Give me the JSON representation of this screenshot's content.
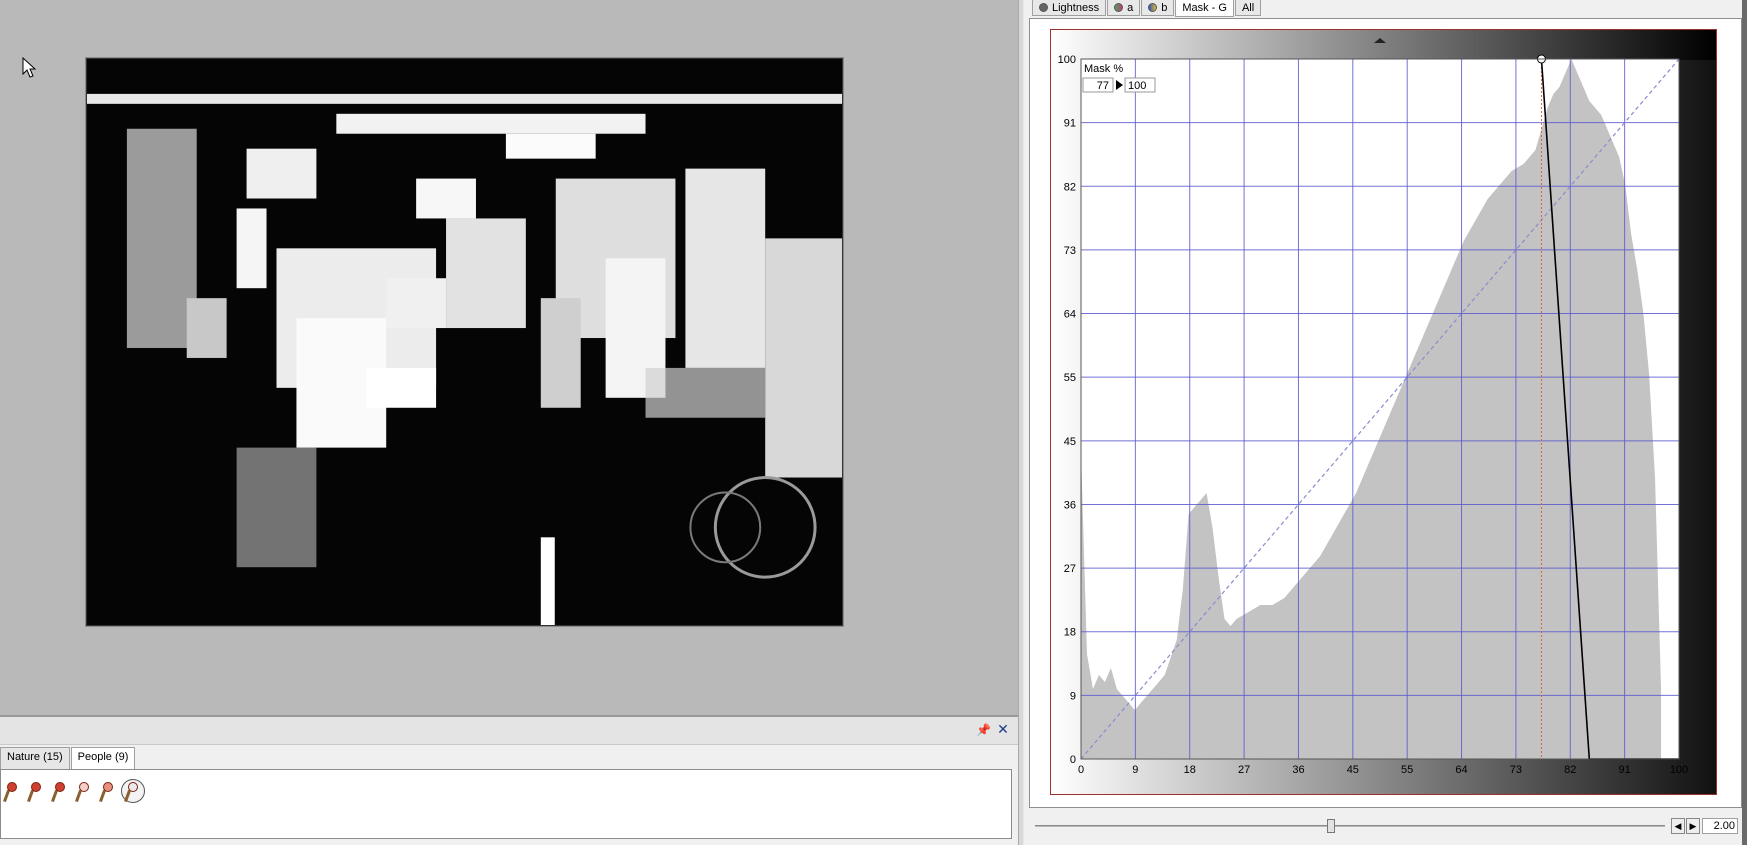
{
  "colors": {
    "viewer_bg": "#b9b9b9",
    "grid": "#5a5ad0",
    "histogram": "#c3c3c3",
    "curve": "#000000",
    "diagonal": "#8a8ad0",
    "marker": "#e06040"
  },
  "bottom_panel": {
    "tabs": [
      {
        "label": "Nature (15)"
      },
      {
        "label": "People (9)"
      }
    ],
    "active_tab": "People (9)",
    "pin_icon": "pin-icon",
    "close_icon": "close-icon"
  },
  "curve_panel": {
    "tabs": [
      {
        "label": "Lightness"
      },
      {
        "label": "a"
      },
      {
        "label": "b"
      },
      {
        "label": "Mask - G"
      },
      {
        "label": "All"
      }
    ],
    "active_tab": "Mask - G",
    "readout_label": "Mask %",
    "readout_input": "77",
    "readout_output": "100",
    "zoom_value": "2.00"
  },
  "chart_data": {
    "type": "area",
    "xlabel": "",
    "ylabel": "",
    "xlim": [
      0,
      100
    ],
    "ylim": [
      0,
      100
    ],
    "x_ticks": [
      "0",
      "9",
      "18",
      "27",
      "36",
      "45",
      "55",
      "64",
      "73",
      "82",
      "91",
      "100"
    ],
    "y_ticks": [
      "0",
      "9",
      "18",
      "27",
      "36",
      "45",
      "55",
      "64",
      "73",
      "82",
      "91",
      "100"
    ],
    "grid": true,
    "histogram": {
      "x": [
        0,
        1,
        2,
        3,
        4,
        5,
        6,
        7,
        8,
        9,
        10,
        12,
        14,
        16,
        17,
        18,
        19,
        20,
        21,
        22,
        23,
        24,
        25,
        26,
        28,
        30,
        32,
        34,
        36,
        38,
        40,
        42,
        44,
        46,
        48,
        50,
        52,
        54,
        56,
        58,
        60,
        62,
        64,
        66,
        68,
        70,
        72,
        74,
        76,
        77,
        78,
        79,
        80,
        81,
        82,
        83,
        84,
        85,
        86,
        87,
        88,
        89,
        90,
        91,
        92,
        93,
        94,
        95,
        96,
        97
      ],
      "y": [
        44,
        15,
        10,
        12,
        11,
        13,
        10,
        9,
        8,
        7,
        8,
        10,
        12,
        17,
        24,
        35,
        36,
        37,
        38,
        33,
        26,
        20,
        19,
        20,
        21,
        22,
        22,
        23,
        25,
        27,
        29,
        32,
        35,
        38,
        42,
        46,
        50,
        54,
        58,
        62,
        66,
        70,
        74,
        77,
        80,
        82,
        84,
        85,
        87,
        90,
        93,
        95,
        96,
        98,
        100,
        98,
        96,
        94,
        93,
        92,
        90,
        88,
        86,
        82,
        75,
        70,
        64,
        55,
        40,
        10
      ]
    },
    "curve": {
      "x": [
        77,
        85,
        100
      ],
      "y": [
        100,
        0,
        0
      ]
    },
    "reference_line": {
      "x": [
        0,
        100
      ],
      "y": [
        0,
        100
      ]
    },
    "marker_x": 77
  }
}
